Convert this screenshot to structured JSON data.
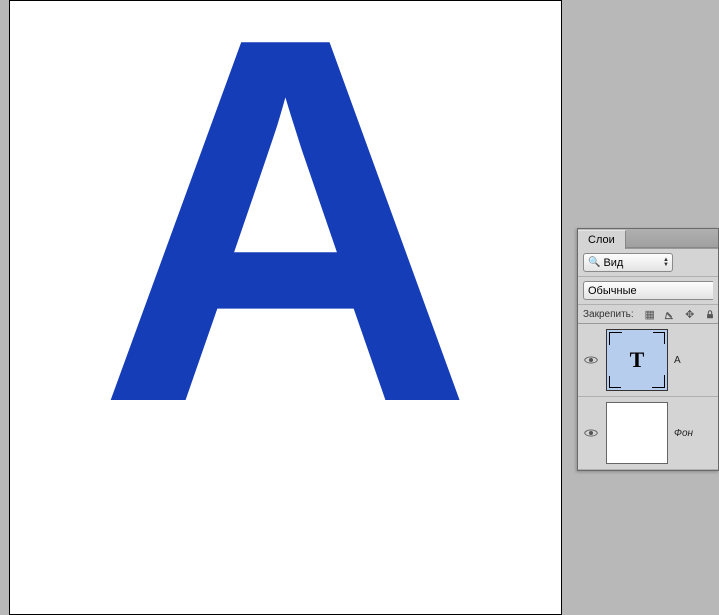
{
  "canvas": {
    "letter": "А",
    "letter_color": "#153db7"
  },
  "panel": {
    "tab_label": "Слои",
    "filter_label": "Вид",
    "blend_mode": "Обычные",
    "lock_label": "Закрепить:"
  },
  "layers": [
    {
      "name": "А",
      "type": "text",
      "visible": true,
      "selected": true,
      "thumb_letter": "T",
      "italic": false
    },
    {
      "name": "Фон",
      "type": "background",
      "visible": true,
      "selected": false,
      "thumb_letter": "",
      "italic": true
    }
  ]
}
